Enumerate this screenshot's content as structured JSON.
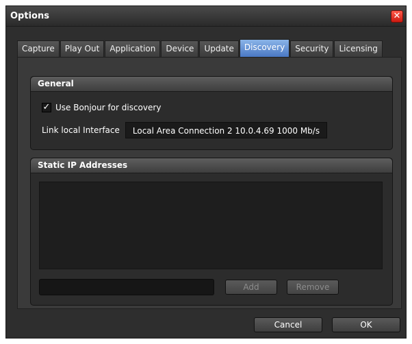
{
  "window": {
    "title": "Options",
    "close_glyph": "✕"
  },
  "tabs": [
    {
      "label": "Capture"
    },
    {
      "label": "Play Out"
    },
    {
      "label": "Application"
    },
    {
      "label": "Device"
    },
    {
      "label": "Update"
    },
    {
      "label": "Discovery",
      "active": true
    },
    {
      "label": "Security"
    },
    {
      "label": "Licensing"
    }
  ],
  "general": {
    "header": "General",
    "bonjour_label": "Use Bonjour for discovery",
    "bonjour_checked": true,
    "check_glyph": "✓",
    "link_label": "Link local Interface",
    "link_value": "Local Area Connection 2  10.0.4.69  1000 Mb/s"
  },
  "static_ip": {
    "header": "Static IP Addresses",
    "input_value": "",
    "add_label": "Add",
    "remove_label": "Remove"
  },
  "footer": {
    "cancel_label": "Cancel",
    "ok_label": "OK"
  },
  "colors": {
    "accent": "#6a98d8",
    "close": "#e02a1c",
    "background": "#2e2e2e"
  }
}
